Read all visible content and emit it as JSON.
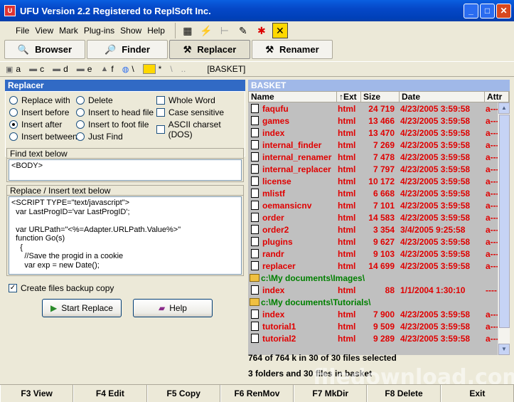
{
  "window": {
    "title": "UFU Version 2.2 Registered to ReplSoft Inc."
  },
  "menu": [
    "File",
    "View",
    "Mark",
    "Plug-ins",
    "Show",
    "Help"
  ],
  "tabs": [
    "Browser",
    "Finder",
    "Replacer",
    "Renamer"
  ],
  "drives": [
    "a",
    "c",
    "d",
    "e",
    "f",
    "\\",
    "*",
    "\\",
    "..",
    "[BASKET]"
  ],
  "left": {
    "header": "Replacer",
    "options": {
      "replace_with": "Replace with",
      "insert_before": "Insert before",
      "insert_after": "Insert after",
      "insert_between": "Insert between",
      "delete": "Delete",
      "insert_head": "Insert to head file",
      "insert_foot": "Insert to foot file",
      "just_find": "Just Find",
      "whole_word": "Whole Word",
      "case_sensitive": "Case sensitive",
      "ascii_charset": "ASCII charset (DOS)"
    },
    "find_label": "Find text below",
    "find_text": "<BODY>",
    "replace_label": "Replace / Insert text below",
    "replace_text": "<SCRIPT TYPE=\"text/javascript\">\n  var LastProgID='var LastProgID';\n\n  var URLPath=\"<%=Adapter.URLPath.Value%>\"\n  function Go(s)\n    {\n      //Save the progid in a cookie\n      var exp = new Date();",
    "backup_label": "Create files backup copy",
    "start_button": "Start Replace",
    "help_button": "Help"
  },
  "right": {
    "header": "BASKET",
    "columns": [
      "Name",
      "↑Ext",
      "Size",
      "Date",
      "Attr"
    ],
    "rows": [
      {
        "type": "file",
        "name": "faqufu",
        "ext": "html",
        "size": "24 719",
        "date": "4/23/2005 3:59:58",
        "attr": "a---"
      },
      {
        "type": "file",
        "name": "games",
        "ext": "html",
        "size": "13 466",
        "date": "4/23/2005 3:59:58",
        "attr": "a---"
      },
      {
        "type": "file",
        "name": "index",
        "ext": "html",
        "size": "13 470",
        "date": "4/23/2005 3:59:58",
        "attr": "a---"
      },
      {
        "type": "file",
        "name": "internal_finder",
        "ext": "html",
        "size": "7 269",
        "date": "4/23/2005 3:59:58",
        "attr": "a---"
      },
      {
        "type": "file",
        "name": "internal_renamer",
        "ext": "html",
        "size": "7 478",
        "date": "4/23/2005 3:59:58",
        "attr": "a---"
      },
      {
        "type": "file",
        "name": "internal_replacer",
        "ext": "html",
        "size": "7 797",
        "date": "4/23/2005 3:59:58",
        "attr": "a---"
      },
      {
        "type": "file",
        "name": "license",
        "ext": "html",
        "size": "10 172",
        "date": "4/23/2005 3:59:58",
        "attr": "a---"
      },
      {
        "type": "file",
        "name": "mlistf",
        "ext": "html",
        "size": "6 668",
        "date": "4/23/2005 3:59:58",
        "attr": "a---"
      },
      {
        "type": "file",
        "name": "oemansicnv",
        "ext": "html",
        "size": "7 101",
        "date": "4/23/2005 3:59:58",
        "attr": "a---"
      },
      {
        "type": "file",
        "name": "order",
        "ext": "html",
        "size": "14 583",
        "date": "4/23/2005 3:59:58",
        "attr": "a---"
      },
      {
        "type": "file",
        "name": "order2",
        "ext": "html",
        "size": "3 354",
        "date": "3/4/2005 9:25:58",
        "attr": "a---"
      },
      {
        "type": "file",
        "name": "plugins",
        "ext": "html",
        "size": "9 627",
        "date": "4/23/2005 3:59:58",
        "attr": "a---"
      },
      {
        "type": "file",
        "name": "randr",
        "ext": "html",
        "size": "9 103",
        "date": "4/23/2005 3:59:58",
        "attr": "a---"
      },
      {
        "type": "file",
        "name": "replacer",
        "ext": "html",
        "size": "14 699",
        "date": "4/23/2005 3:59:58",
        "attr": "a---"
      },
      {
        "type": "folder",
        "name": "c:\\My documents\\Images\\"
      },
      {
        "type": "file",
        "name": "index",
        "ext": "html",
        "size": "88",
        "date": "1/1/2004 1:30:10",
        "attr": "----"
      },
      {
        "type": "folder",
        "name": "c:\\My documents\\Tutorials\\"
      },
      {
        "type": "file",
        "name": "index",
        "ext": "html",
        "size": "7 900",
        "date": "4/23/2005 3:59:58",
        "attr": "a---"
      },
      {
        "type": "file",
        "name": "tutorial1",
        "ext": "html",
        "size": "9 509",
        "date": "4/23/2005 3:59:58",
        "attr": "a---"
      },
      {
        "type": "file",
        "name": "tutorial2",
        "ext": "html",
        "size": "9 289",
        "date": "4/23/2005 3:59:58",
        "attr": "a---"
      }
    ],
    "status1": "764 of 764 k in 30 of 30 files selected",
    "status2": "3 folders and 30 files in basket"
  },
  "fkeys": [
    "F3 View",
    "F4 Edit",
    "F5 Copy",
    "F6 RenMov",
    "F7 MkDir",
    "F8 Delete",
    "Exit"
  ],
  "watermark": "filedownload.com"
}
